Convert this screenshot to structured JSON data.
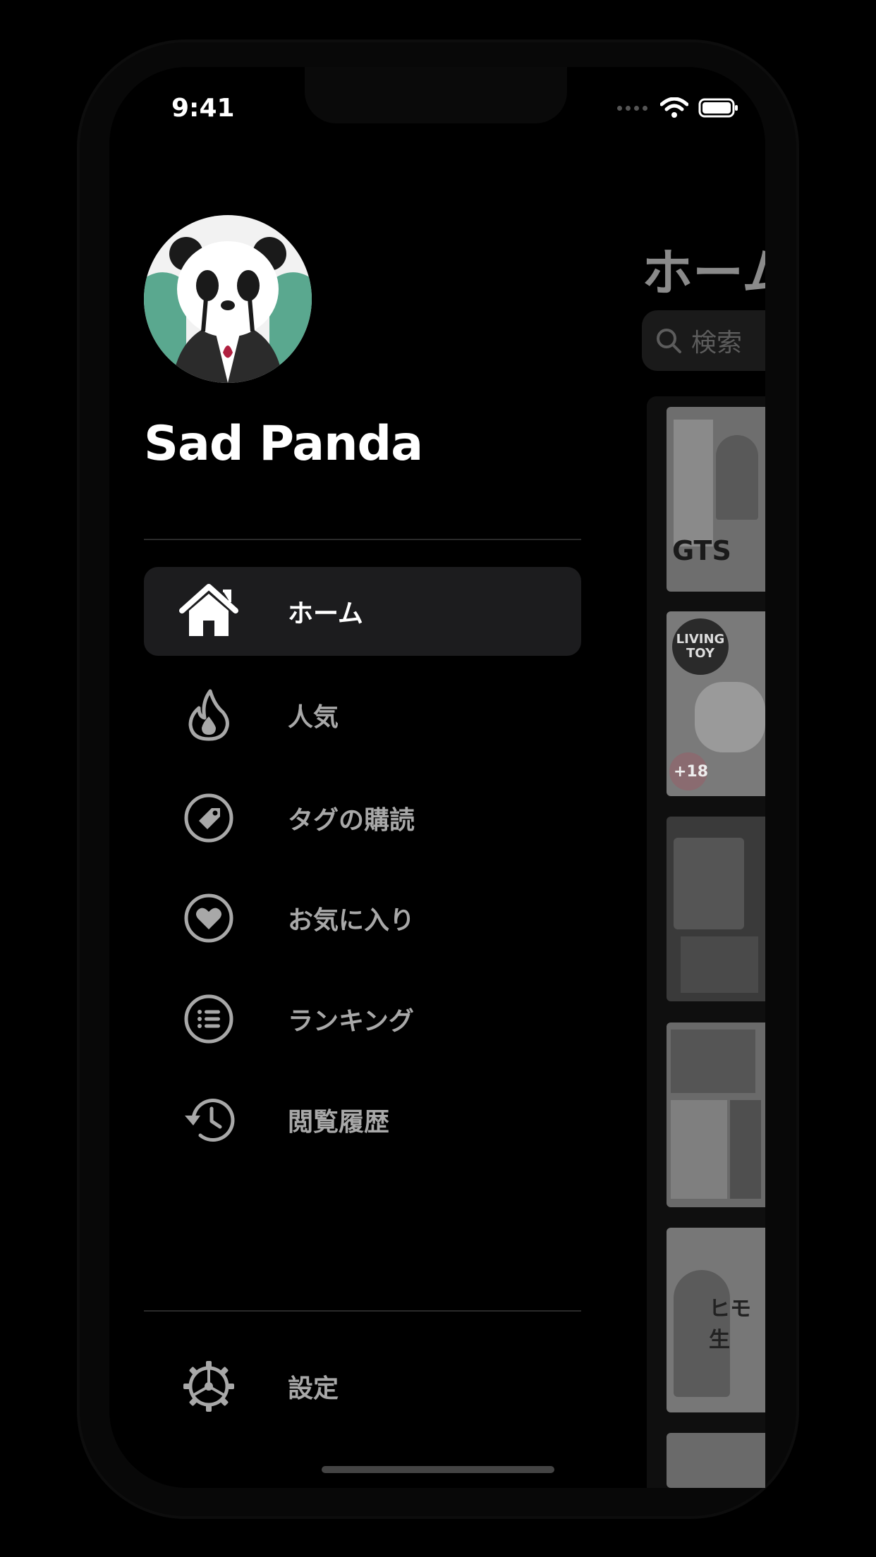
{
  "status_bar": {
    "time": "9:41"
  },
  "drawer": {
    "profile_name": "Sad Panda",
    "menu": [
      {
        "label": "ホーム",
        "icon": "house-icon",
        "selected": true
      },
      {
        "label": "人気",
        "icon": "flame-icon",
        "selected": false
      },
      {
        "label": "タグの購読",
        "icon": "tag-icon",
        "selected": false
      },
      {
        "label": "お気に入り",
        "icon": "heart-icon",
        "selected": false
      },
      {
        "label": "ランキング",
        "icon": "list-icon",
        "selected": false
      },
      {
        "label": "閲覧履歴",
        "icon": "history-icon",
        "selected": false
      }
    ],
    "settings_label": "設定"
  },
  "home": {
    "title": "ホーム",
    "search_placeholder": "検索",
    "thumbnail_texts": [
      "GTS",
      "LIVING TOY",
      "+18",
      "",
      "ヒモ生",
      ""
    ]
  },
  "colors": {
    "accent_text": "#ffffff",
    "inactive_text": "#a8a8a8",
    "selected_bg": "#1c1c1e"
  }
}
